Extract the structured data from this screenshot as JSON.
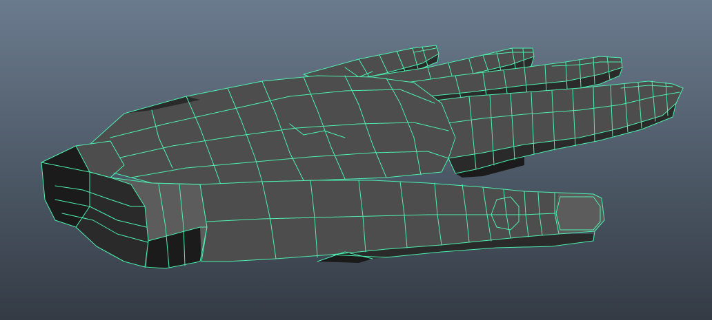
{
  "viewport": {
    "background_top": "#6b7b8e",
    "background_bottom": "#343b45",
    "wireframe_color": "#4df0b0",
    "mesh_fill": "#5a5a5a",
    "shadow_fill": "#1e1e1e"
  },
  "model": {
    "name": "hand-mesh",
    "display_mode": "wireframe-on-shaded",
    "selected": true
  }
}
